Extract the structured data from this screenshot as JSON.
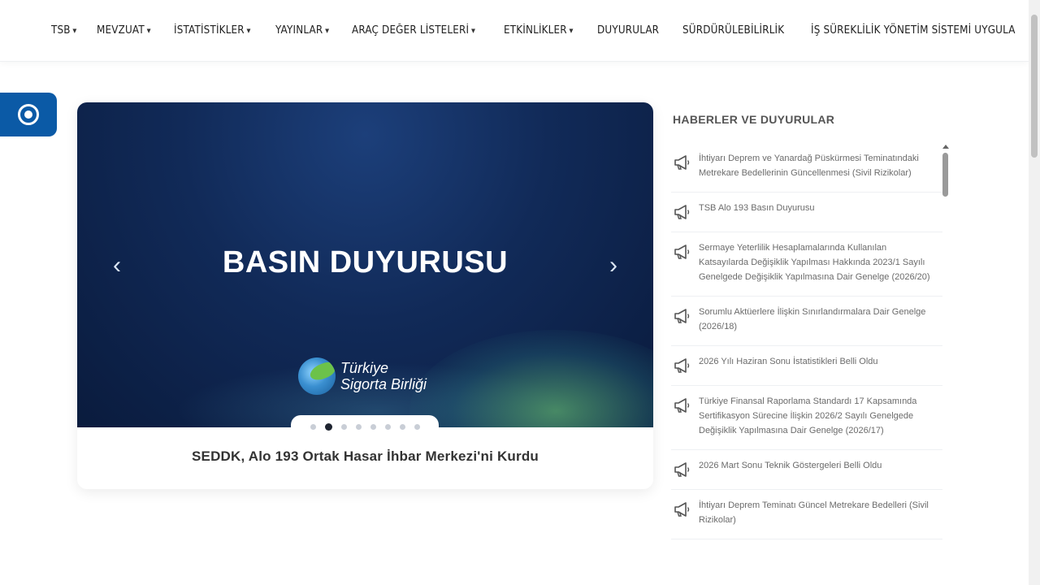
{
  "nav": {
    "items": [
      {
        "label": "TSB",
        "dropdown": true
      },
      {
        "label": "MEVZUAT",
        "dropdown": true
      },
      {
        "label": "İSTATİSTİKLER",
        "dropdown": true
      },
      {
        "label": "YAYINLAR",
        "dropdown": true
      },
      {
        "label": "ARAÇ DEĞER LİSTELERİ",
        "dropdown": true
      },
      {
        "label": "ETKİNLİKLER",
        "dropdown": true
      },
      {
        "label": "DUYURULAR",
        "dropdown": false
      },
      {
        "label": "SÜRDÜRÜLEBİLİRLİK",
        "dropdown": false
      },
      {
        "label": "İŞ SÜREKLİLİK YÖNETİM SİSTEMİ UYGULA",
        "dropdown": false
      }
    ]
  },
  "slider": {
    "slide_title": "BASIN DUYURUSU",
    "prev_icon": "‹",
    "next_icon": "›",
    "logo_line1": "Türkiye",
    "logo_line2": "Sigorta Birliği",
    "dot_count": 8,
    "active_dot": 1,
    "caption": "SEDDK, Alo 193 Ortak Hasar İhbar Merkezi'ni Kurdu"
  },
  "news": {
    "title": "HABERLER VE DUYURULAR",
    "items": [
      "İhtiyarı Deprem ve Yanardağ Püskürmesi Teminatındaki Metrekare Bedellerinin Güncellenmesi (Sivil Rizikolar)",
      "TSB Alo 193 Basın Duyurusu",
      "Sermaye Yeterlilik Hesaplamalarında Kullanılan Katsayılarda Değişiklik Yapılması Hakkında 2023/1 Sayılı Genelgede Değişiklik Yapılmasına Dair Genelge (2026/20)",
      "Sorumlu Aktüerlere İlişkin Sınırlandırmalara Dair Genelge (2026/18)",
      "2026 Yılı Haziran Sonu İstatistikleri Belli Oldu",
      "Türkiye Finansal Raporlama Standardı 17 Kapsamında Sertifikasyon Sürecine İlişkin 2026/2 Sayılı Genelgede Değişiklik Yapılmasına Dair Genelge (2026/17)",
      "2026 Mart Sonu Teknik Göstergeleri Belli Oldu",
      "İhtiyarı Deprem Teminatı Güncel Metrekare Bedelleri (Sivil Rizikolar)"
    ]
  },
  "colors": {
    "brand_blue": "#0b5aa6",
    "slide_bg": "#112a58"
  }
}
